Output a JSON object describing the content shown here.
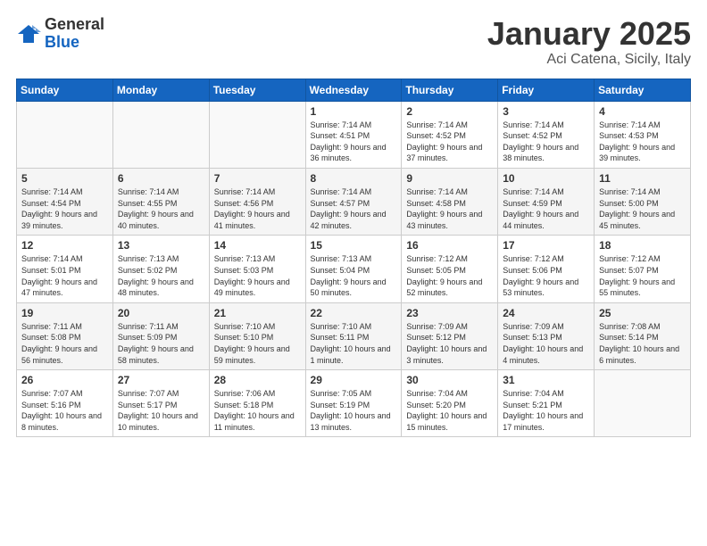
{
  "logo": {
    "general": "General",
    "blue": "Blue"
  },
  "title": "January 2025",
  "subtitle": "Aci Catena, Sicily, Italy",
  "weekdays": [
    "Sunday",
    "Monday",
    "Tuesday",
    "Wednesday",
    "Thursday",
    "Friday",
    "Saturday"
  ],
  "weeks": [
    [
      {
        "day": "",
        "info": ""
      },
      {
        "day": "",
        "info": ""
      },
      {
        "day": "",
        "info": ""
      },
      {
        "day": "1",
        "info": "Sunrise: 7:14 AM\nSunset: 4:51 PM\nDaylight: 9 hours and 36 minutes."
      },
      {
        "day": "2",
        "info": "Sunrise: 7:14 AM\nSunset: 4:52 PM\nDaylight: 9 hours and 37 minutes."
      },
      {
        "day": "3",
        "info": "Sunrise: 7:14 AM\nSunset: 4:52 PM\nDaylight: 9 hours and 38 minutes."
      },
      {
        "day": "4",
        "info": "Sunrise: 7:14 AM\nSunset: 4:53 PM\nDaylight: 9 hours and 39 minutes."
      }
    ],
    [
      {
        "day": "5",
        "info": "Sunrise: 7:14 AM\nSunset: 4:54 PM\nDaylight: 9 hours and 39 minutes."
      },
      {
        "day": "6",
        "info": "Sunrise: 7:14 AM\nSunset: 4:55 PM\nDaylight: 9 hours and 40 minutes."
      },
      {
        "day": "7",
        "info": "Sunrise: 7:14 AM\nSunset: 4:56 PM\nDaylight: 9 hours and 41 minutes."
      },
      {
        "day": "8",
        "info": "Sunrise: 7:14 AM\nSunset: 4:57 PM\nDaylight: 9 hours and 42 minutes."
      },
      {
        "day": "9",
        "info": "Sunrise: 7:14 AM\nSunset: 4:58 PM\nDaylight: 9 hours and 43 minutes."
      },
      {
        "day": "10",
        "info": "Sunrise: 7:14 AM\nSunset: 4:59 PM\nDaylight: 9 hours and 44 minutes."
      },
      {
        "day": "11",
        "info": "Sunrise: 7:14 AM\nSunset: 5:00 PM\nDaylight: 9 hours and 45 minutes."
      }
    ],
    [
      {
        "day": "12",
        "info": "Sunrise: 7:14 AM\nSunset: 5:01 PM\nDaylight: 9 hours and 47 minutes."
      },
      {
        "day": "13",
        "info": "Sunrise: 7:13 AM\nSunset: 5:02 PM\nDaylight: 9 hours and 48 minutes."
      },
      {
        "day": "14",
        "info": "Sunrise: 7:13 AM\nSunset: 5:03 PM\nDaylight: 9 hours and 49 minutes."
      },
      {
        "day": "15",
        "info": "Sunrise: 7:13 AM\nSunset: 5:04 PM\nDaylight: 9 hours and 50 minutes."
      },
      {
        "day": "16",
        "info": "Sunrise: 7:12 AM\nSunset: 5:05 PM\nDaylight: 9 hours and 52 minutes."
      },
      {
        "day": "17",
        "info": "Sunrise: 7:12 AM\nSunset: 5:06 PM\nDaylight: 9 hours and 53 minutes."
      },
      {
        "day": "18",
        "info": "Sunrise: 7:12 AM\nSunset: 5:07 PM\nDaylight: 9 hours and 55 minutes."
      }
    ],
    [
      {
        "day": "19",
        "info": "Sunrise: 7:11 AM\nSunset: 5:08 PM\nDaylight: 9 hours and 56 minutes."
      },
      {
        "day": "20",
        "info": "Sunrise: 7:11 AM\nSunset: 5:09 PM\nDaylight: 9 hours and 58 minutes."
      },
      {
        "day": "21",
        "info": "Sunrise: 7:10 AM\nSunset: 5:10 PM\nDaylight: 9 hours and 59 minutes."
      },
      {
        "day": "22",
        "info": "Sunrise: 7:10 AM\nSunset: 5:11 PM\nDaylight: 10 hours and 1 minute."
      },
      {
        "day": "23",
        "info": "Sunrise: 7:09 AM\nSunset: 5:12 PM\nDaylight: 10 hours and 3 minutes."
      },
      {
        "day": "24",
        "info": "Sunrise: 7:09 AM\nSunset: 5:13 PM\nDaylight: 10 hours and 4 minutes."
      },
      {
        "day": "25",
        "info": "Sunrise: 7:08 AM\nSunset: 5:14 PM\nDaylight: 10 hours and 6 minutes."
      }
    ],
    [
      {
        "day": "26",
        "info": "Sunrise: 7:07 AM\nSunset: 5:16 PM\nDaylight: 10 hours and 8 minutes."
      },
      {
        "day": "27",
        "info": "Sunrise: 7:07 AM\nSunset: 5:17 PM\nDaylight: 10 hours and 10 minutes."
      },
      {
        "day": "28",
        "info": "Sunrise: 7:06 AM\nSunset: 5:18 PM\nDaylight: 10 hours and 11 minutes."
      },
      {
        "day": "29",
        "info": "Sunrise: 7:05 AM\nSunset: 5:19 PM\nDaylight: 10 hours and 13 minutes."
      },
      {
        "day": "30",
        "info": "Sunrise: 7:04 AM\nSunset: 5:20 PM\nDaylight: 10 hours and 15 minutes."
      },
      {
        "day": "31",
        "info": "Sunrise: 7:04 AM\nSunset: 5:21 PM\nDaylight: 10 hours and 17 minutes."
      },
      {
        "day": "",
        "info": ""
      }
    ]
  ]
}
